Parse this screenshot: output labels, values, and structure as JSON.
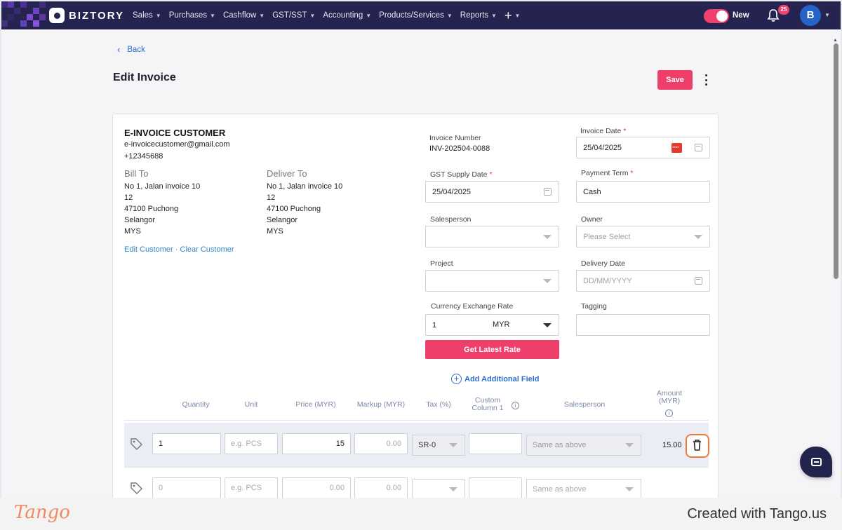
{
  "app": {
    "name": "BIZTORY"
  },
  "nav": {
    "items": [
      "Sales",
      "Purchases",
      "Cashflow",
      "GST/SST",
      "Accounting",
      "Products/Services",
      "Reports"
    ],
    "plus": "+",
    "toggle_label": "New",
    "notifications": "25",
    "avatar": "B"
  },
  "header": {
    "back": "Back",
    "title": "Edit Invoice",
    "save": "Save"
  },
  "customer": {
    "name": "E-INVOICE CUSTOMER",
    "email": "e-invoicecustomer@gmail.com",
    "phone": "+12345688",
    "bill_to": {
      "title": "Bill To",
      "lines": [
        "No 1, Jalan invoice 10",
        "12",
        "47100 Puchong",
        "Selangor",
        "MYS"
      ]
    },
    "deliver_to": {
      "title": "Deliver To",
      "lines": [
        "No 1, Jalan invoice 10",
        "12",
        "47100 Puchong",
        "Selangor",
        "MYS"
      ]
    },
    "edit_link": "Edit Customer",
    "separator": "·",
    "clear_link": "Clear Customer"
  },
  "fields": {
    "invoice_number": {
      "label": "Invoice Number",
      "value": "INV-202504-0088"
    },
    "invoice_date": {
      "label": "Invoice Date",
      "required": "*",
      "value": "25/04/2025"
    },
    "gst_supply_date": {
      "label": "GST Supply Date",
      "required": "*",
      "value": "25/04/2025"
    },
    "payment_term": {
      "label": "Payment Term",
      "required": "*",
      "value": "Cash"
    },
    "salesperson": {
      "label": "Salesperson",
      "value": ""
    },
    "owner": {
      "label": "Owner",
      "placeholder": "Please Select"
    },
    "project": {
      "label": "Project",
      "value": ""
    },
    "delivery_date": {
      "label": "Delivery Date",
      "placeholder": "DD/MM/YYYY"
    },
    "currency_exchange_rate": {
      "label": "Currency Exchange Rate",
      "value": "1",
      "currency": "MYR"
    },
    "tagging": {
      "label": "Tagging",
      "value": ""
    }
  },
  "buttons": {
    "get_latest_rate": "Get Latest Rate",
    "add_field": "Add Additional Field"
  },
  "table": {
    "headers": {
      "quantity": "Quantity",
      "unit": "Unit",
      "price": "Price (MYR)",
      "markup": "Markup (MYR)",
      "tax": "Tax (%)",
      "custom1": "Custom",
      "custom2": "Column 1",
      "salesperson": "Salesperson",
      "amount1": "Amount",
      "amount2": "(MYR)"
    },
    "rows": [
      {
        "quantity": "1",
        "unit_placeholder": "e.g. PCS",
        "price": "15",
        "markup": "0.00",
        "tax": "SR-0",
        "custom": "",
        "salesperson": "Same as above",
        "amount": "15.00"
      },
      {
        "quantity": "0",
        "unit_placeholder": "e.g. PCS",
        "price": "0.00",
        "markup": "0.00",
        "tax": "",
        "custom": "",
        "salesperson": "Same as above",
        "amount": ""
      }
    ]
  },
  "footer": {
    "brand": "Tango",
    "credit": "Created with Tango.us"
  },
  "colors": {
    "nav_bg": "#25234f",
    "accent": "#ee3e6a",
    "link": "#2d6fcc",
    "highlight": "#f07a3a"
  }
}
